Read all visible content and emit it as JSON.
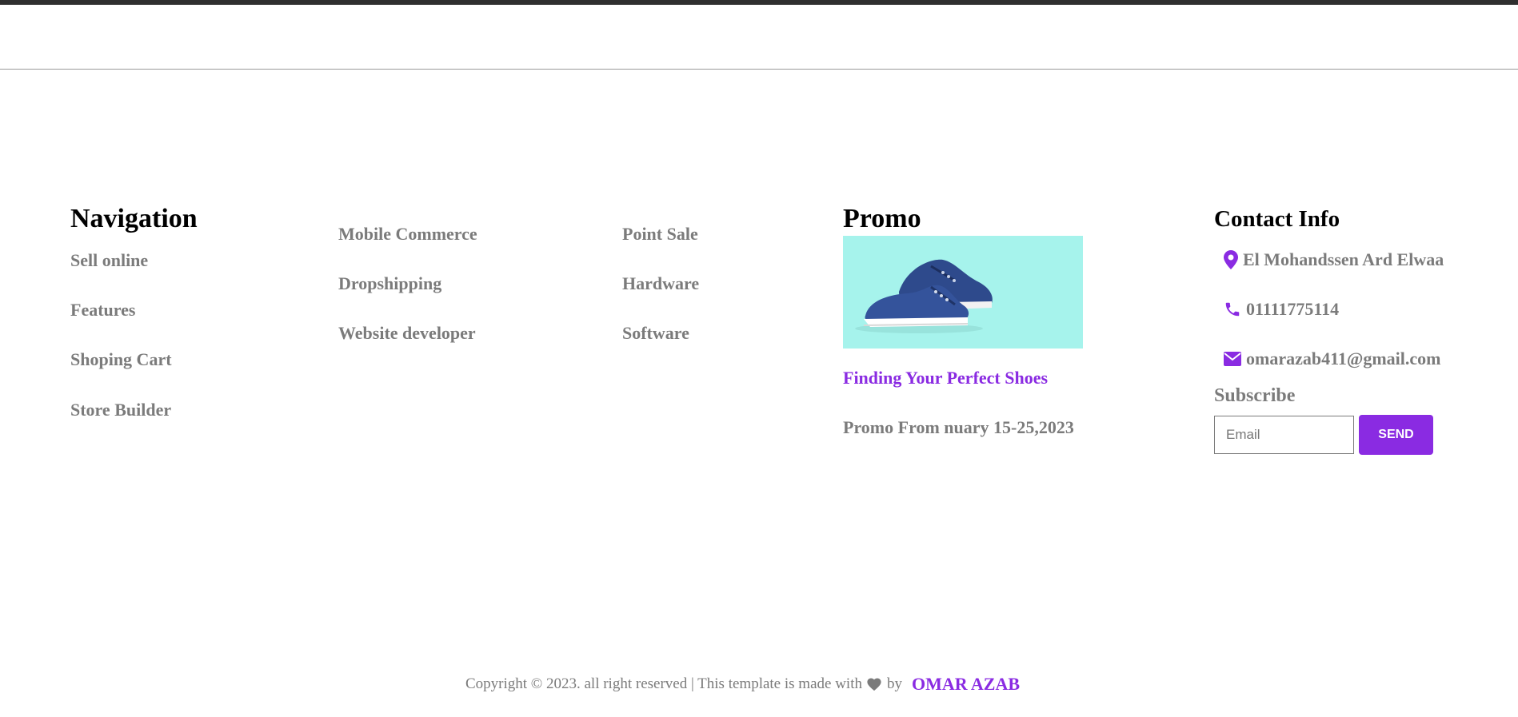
{
  "navigation": {
    "title": "Navigation",
    "links": [
      "Sell online",
      "Features",
      "Shoping Cart",
      "Store Builder"
    ]
  },
  "column2": {
    "links": [
      "Mobile Commerce",
      "Dropshipping",
      "Website developer"
    ]
  },
  "column3": {
    "links": [
      "Point Sale",
      "Hardware",
      "Software"
    ]
  },
  "promo": {
    "title": "Promo",
    "image": "blue-sneakers-on-mint-background",
    "link_text": "Finding Your Perfect Shoes",
    "date_text": "Promo From nuary 15-25,2023"
  },
  "contact": {
    "title": "Contact Info",
    "address": "El Mohandssen Ard Elwaa",
    "phone": "01111775114",
    "email": "omarazab411@gmail.com",
    "icons": [
      "location-pin-icon",
      "phone-icon",
      "envelope-icon"
    ],
    "subscribe_label": "Subscribe",
    "email_placeholder": "Email",
    "send_label": "SEND"
  },
  "footer": {
    "copyright": "Copyright © 2023. all right reserved | This template is made with",
    "by": "by",
    "author": "OMAR AZAB"
  },
  "colors": {
    "accent": "#8a2be2",
    "muted_text": "#7b7b7b",
    "promo_bg": "#a6f3ec",
    "topbar": "#2f2f2f"
  }
}
